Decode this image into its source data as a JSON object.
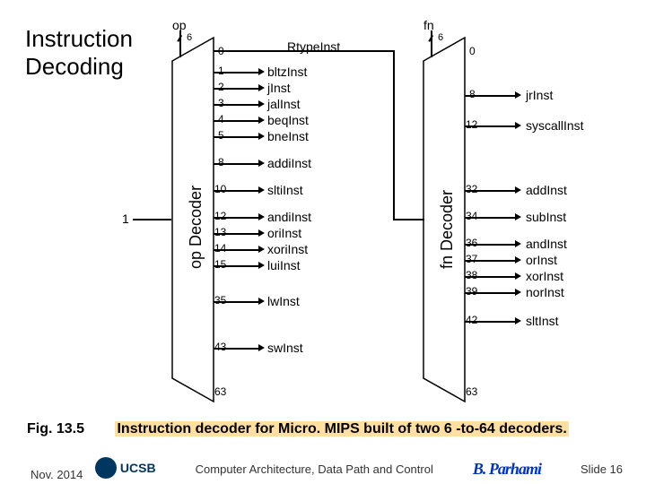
{
  "meta": {
    "title_line1": "Instruction",
    "title_line2": "Decoding",
    "caption_fig": "Fig. 13.5",
    "caption_text": "Instruction decoder for Micro. MIPS built of two 6 -to-64 decoders.",
    "footer_date": "Nov. 2014",
    "footer_center": "Computer Architecture, Data Path and Control",
    "footer_author": "B. Parhami",
    "footer_slide": "Slide 16",
    "ucsb": "UCSB"
  },
  "op_decoder": {
    "input_label": "op",
    "bits": "6",
    "name": "op Decoder",
    "enable": "1",
    "range_lo": "0",
    "range_hi": "63",
    "outputs": [
      {
        "n": "0",
        "sig": "RtypeInst"
      },
      {
        "n": "1",
        "sig": "bltzInst"
      },
      {
        "n": "2",
        "sig": "jInst"
      },
      {
        "n": "3",
        "sig": "jalInst"
      },
      {
        "n": "4",
        "sig": "beqInst"
      },
      {
        "n": "5",
        "sig": "bneInst"
      },
      {
        "n": "8",
        "sig": "addiInst"
      },
      {
        "n": "10",
        "sig": "sltiInst"
      },
      {
        "n": "12",
        "sig": "andiInst"
      },
      {
        "n": "13",
        "sig": "oriInst"
      },
      {
        "n": "14",
        "sig": "xoriInst"
      },
      {
        "n": "15",
        "sig": "luiInst"
      },
      {
        "n": "35",
        "sig": "lwInst"
      },
      {
        "n": "43",
        "sig": "swInst"
      }
    ]
  },
  "fn_decoder": {
    "input_label": "fn",
    "bits": "6",
    "name": "fn Decoder",
    "range_lo": "0",
    "range_hi": "63",
    "outputs": [
      {
        "n": "8",
        "sig": "jrInst"
      },
      {
        "n": "12",
        "sig": "syscallInst"
      },
      {
        "n": "32",
        "sig": "addInst"
      },
      {
        "n": "34",
        "sig": "subInst"
      },
      {
        "n": "36",
        "sig": "andInst"
      },
      {
        "n": "37",
        "sig": "orInst"
      },
      {
        "n": "38",
        "sig": "xorInst"
      },
      {
        "n": "39",
        "sig": "norInst"
      },
      {
        "n": "42",
        "sig": "sltInst"
      }
    ]
  }
}
